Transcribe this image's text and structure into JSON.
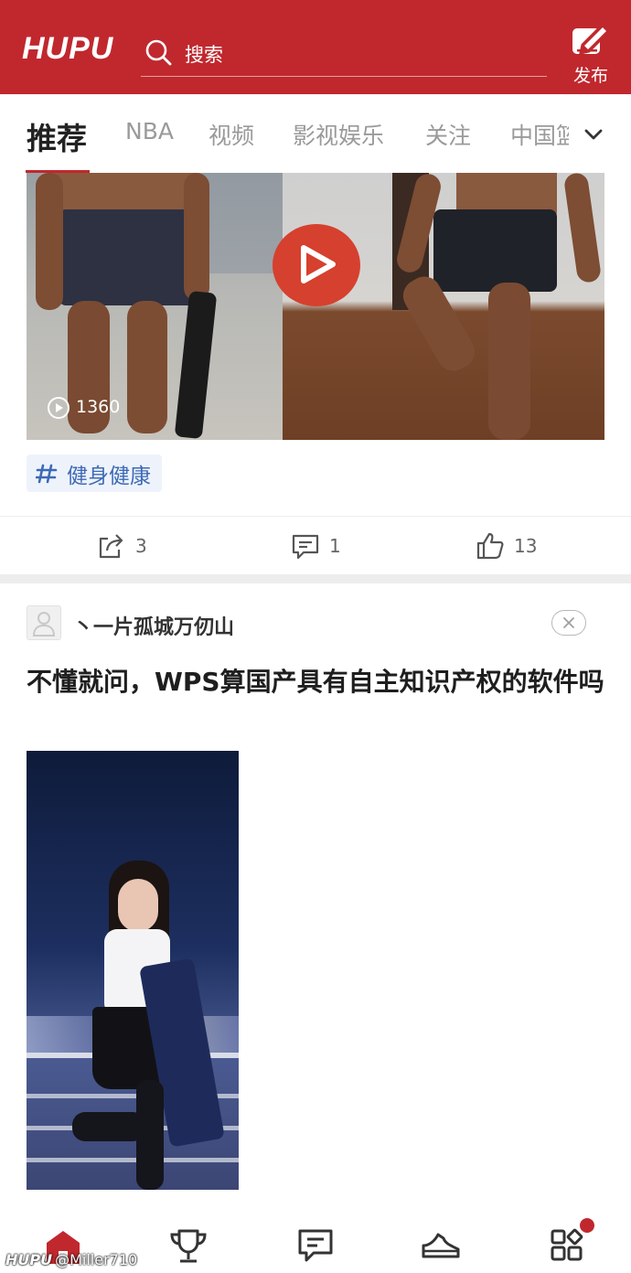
{
  "header": {
    "logo": "HUPU",
    "search_placeholder": "搜索",
    "publish_label": "发布",
    "brand_color": "#c0282e"
  },
  "tabs": [
    {
      "label": "推荐",
      "active": true
    },
    {
      "label": "NBA",
      "active": false
    },
    {
      "label": "视频",
      "active": false
    },
    {
      "label": "影视娱乐",
      "active": false
    },
    {
      "label": "关注",
      "active": false
    },
    {
      "label": "中国篮",
      "active": false
    }
  ],
  "video_card": {
    "view_count": "1360",
    "topic": "健身健康",
    "shares": "3",
    "comments": "1",
    "likes": "13"
  },
  "post_card": {
    "username": "丶一片孤城万仞山",
    "title": "不懂就问，WPS算国产具有自主知识产权的软件吗"
  },
  "bottom_nav": {
    "items": [
      "home-icon",
      "trophy-icon",
      "chat-icon",
      "sneaker-icon",
      "more-icon"
    ],
    "has_badge": true
  },
  "watermark": {
    "logo": "HUPU",
    "user": "@Miller710"
  }
}
